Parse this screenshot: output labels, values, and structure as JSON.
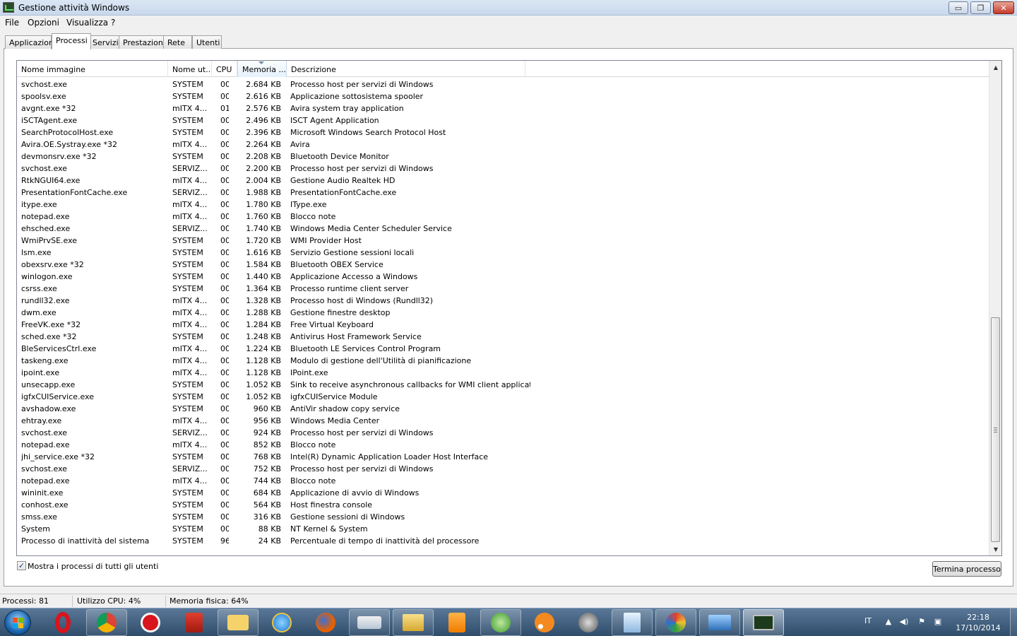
{
  "window": {
    "title": "Gestione attività Windows",
    "minimize_glyph": "▭",
    "maximize_glyph": "❐",
    "close_glyph": "✕"
  },
  "menu": [
    "File",
    "Opzioni",
    "Visualizza",
    "?"
  ],
  "tabs": [
    "Applicazioni",
    "Processi",
    "Servizi",
    "Prestazioni",
    "Rete",
    "Utenti"
  ],
  "active_tab": "Processi",
  "columns": {
    "name": "Nome immagine",
    "user": "Nome ut...",
    "cpu": "CPU",
    "memory": "Memoria ...",
    "description": "Descrizione"
  },
  "processes": [
    {
      "name": "svchost.exe",
      "user": "SYSTEM",
      "cpu": "00",
      "mem": "2.684 KB",
      "desc": "Processo host per servizi di Windows"
    },
    {
      "name": "spoolsv.exe",
      "user": "SYSTEM",
      "cpu": "00",
      "mem": "2.616 KB",
      "desc": "Applicazione sottosistema spooler"
    },
    {
      "name": "avgnt.exe *32",
      "user": "mITX 4...",
      "cpu": "01",
      "mem": "2.576 KB",
      "desc": "Avira system tray application"
    },
    {
      "name": "iSCTAgent.exe",
      "user": "SYSTEM",
      "cpu": "00",
      "mem": "2.496 KB",
      "desc": "ISCT Agent Application"
    },
    {
      "name": "SearchProtocolHost.exe",
      "user": "SYSTEM",
      "cpu": "00",
      "mem": "2.396 KB",
      "desc": "Microsoft Windows Search Protocol Host"
    },
    {
      "name": "Avira.OE.Systray.exe *32",
      "user": "mITX 4...",
      "cpu": "00",
      "mem": "2.264 KB",
      "desc": "Avira"
    },
    {
      "name": "devmonsrv.exe *32",
      "user": "SYSTEM",
      "cpu": "00",
      "mem": "2.208 KB",
      "desc": "Bluetooth Device Monitor"
    },
    {
      "name": "svchost.exe",
      "user": "SERVIZ...",
      "cpu": "00",
      "mem": "2.200 KB",
      "desc": "Processo host per servizi di Windows"
    },
    {
      "name": "RtkNGUI64.exe",
      "user": "mITX 4...",
      "cpu": "00",
      "mem": "2.004 KB",
      "desc": "Gestione Audio Realtek HD"
    },
    {
      "name": "PresentationFontCache.exe",
      "user": "SERVIZ...",
      "cpu": "00",
      "mem": "1.988 KB",
      "desc": "PresentationFontCache.exe"
    },
    {
      "name": "itype.exe",
      "user": "mITX 4...",
      "cpu": "00",
      "mem": "1.780 KB",
      "desc": "IType.exe"
    },
    {
      "name": "notepad.exe",
      "user": "mITX 4...",
      "cpu": "00",
      "mem": "1.760 KB",
      "desc": "Blocco note"
    },
    {
      "name": "ehsched.exe",
      "user": "SERVIZ...",
      "cpu": "00",
      "mem": "1.740 KB",
      "desc": "Windows Media Center Scheduler Service"
    },
    {
      "name": "WmiPrvSE.exe",
      "user": "SYSTEM",
      "cpu": "00",
      "mem": "1.720 KB",
      "desc": "WMI Provider Host"
    },
    {
      "name": "lsm.exe",
      "user": "SYSTEM",
      "cpu": "00",
      "mem": "1.616 KB",
      "desc": "Servizio Gestione sessioni locali"
    },
    {
      "name": "obexsrv.exe *32",
      "user": "SYSTEM",
      "cpu": "00",
      "mem": "1.584 KB",
      "desc": "Bluetooth OBEX Service"
    },
    {
      "name": "winlogon.exe",
      "user": "SYSTEM",
      "cpu": "00",
      "mem": "1.440 KB",
      "desc": "Applicazione Accesso a Windows"
    },
    {
      "name": "csrss.exe",
      "user": "SYSTEM",
      "cpu": "00",
      "mem": "1.364 KB",
      "desc": "Processo runtime client server"
    },
    {
      "name": "rundll32.exe",
      "user": "mITX 4...",
      "cpu": "00",
      "mem": "1.328 KB",
      "desc": "Processo host di Windows (Rundll32)"
    },
    {
      "name": "dwm.exe",
      "user": "mITX 4...",
      "cpu": "00",
      "mem": "1.288 KB",
      "desc": "Gestione finestre desktop"
    },
    {
      "name": "FreeVK.exe *32",
      "user": "mITX 4...",
      "cpu": "00",
      "mem": "1.284 KB",
      "desc": "Free Virtual Keyboard"
    },
    {
      "name": "sched.exe *32",
      "user": "SYSTEM",
      "cpu": "00",
      "mem": "1.248 KB",
      "desc": "Antivirus Host Framework Service"
    },
    {
      "name": "BleServicesCtrl.exe",
      "user": "mITX 4...",
      "cpu": "00",
      "mem": "1.224 KB",
      "desc": "Bluetooth LE Services Control Program"
    },
    {
      "name": "taskeng.exe",
      "user": "mITX 4...",
      "cpu": "00",
      "mem": "1.128 KB",
      "desc": "Modulo di gestione dell'Utilità di pianificazione"
    },
    {
      "name": "ipoint.exe",
      "user": "mITX 4...",
      "cpu": "00",
      "mem": "1.128 KB",
      "desc": "IPoint.exe"
    },
    {
      "name": "unsecapp.exe",
      "user": "SYSTEM",
      "cpu": "00",
      "mem": "1.052 KB",
      "desc": "Sink to receive asynchronous callbacks for WMI client application"
    },
    {
      "name": "igfxCUIService.exe",
      "user": "SYSTEM",
      "cpu": "00",
      "mem": "1.052 KB",
      "desc": "igfxCUIService Module"
    },
    {
      "name": "avshadow.exe",
      "user": "SYSTEM",
      "cpu": "00",
      "mem": "960 KB",
      "desc": "AntiVir shadow copy service"
    },
    {
      "name": "ehtray.exe",
      "user": "mITX 4...",
      "cpu": "00",
      "mem": "956 KB",
      "desc": "Windows Media Center"
    },
    {
      "name": "svchost.exe",
      "user": "SERVIZ...",
      "cpu": "00",
      "mem": "924 KB",
      "desc": "Processo host per servizi di Windows"
    },
    {
      "name": "notepad.exe",
      "user": "mITX 4...",
      "cpu": "00",
      "mem": "852 KB",
      "desc": "Blocco note"
    },
    {
      "name": "jhi_service.exe *32",
      "user": "SYSTEM",
      "cpu": "00",
      "mem": "768 KB",
      "desc": "Intel(R) Dynamic Application Loader Host Interface"
    },
    {
      "name": "svchost.exe",
      "user": "SERVIZ...",
      "cpu": "00",
      "mem": "752 KB",
      "desc": "Processo host per servizi di Windows"
    },
    {
      "name": "notepad.exe",
      "user": "mITX 4...",
      "cpu": "00",
      "mem": "744 KB",
      "desc": "Blocco note"
    },
    {
      "name": "wininit.exe",
      "user": "SYSTEM",
      "cpu": "00",
      "mem": "684 KB",
      "desc": "Applicazione di avvio di Windows"
    },
    {
      "name": "conhost.exe",
      "user": "SYSTEM",
      "cpu": "00",
      "mem": "564 KB",
      "desc": "Host finestra console"
    },
    {
      "name": "smss.exe",
      "user": "SYSTEM",
      "cpu": "00",
      "mem": "316 KB",
      "desc": "Gestione sessioni di Windows"
    },
    {
      "name": "System",
      "user": "SYSTEM",
      "cpu": "00",
      "mem": "88 KB",
      "desc": "NT Kernel & System"
    },
    {
      "name": "Processo di inattività del sistema",
      "user": "SYSTEM",
      "cpu": "96",
      "mem": "24 KB",
      "desc": "Percentuale di tempo di inattività del processore"
    }
  ],
  "show_all_users": {
    "label": "Mostra i processi di tutti gli utenti",
    "checked_glyph": "✓"
  },
  "end_process_label": "Termina processo",
  "status": {
    "processes": "Processi: 81",
    "cpu": "Utilizzo CPU: 4%",
    "memory": "Memoria fisica: 64%"
  },
  "taskbar": {
    "items": [
      "start-icon",
      "opera-icon",
      "chrome-icon",
      "opera-red-icon",
      "app-shield-icon",
      "mail-icon",
      "ie-icon",
      "firefox-icon",
      "keyboard-icon",
      "explorer-icon",
      "media-player-icon",
      "windows-media-center-icon",
      "feed-icon",
      "satellite-icon",
      "notepad-icon",
      "paint-icon",
      "image-viewer-icon",
      "task-manager-icon"
    ],
    "language": "IT",
    "time": "22:18",
    "date": "17/10/2014"
  }
}
